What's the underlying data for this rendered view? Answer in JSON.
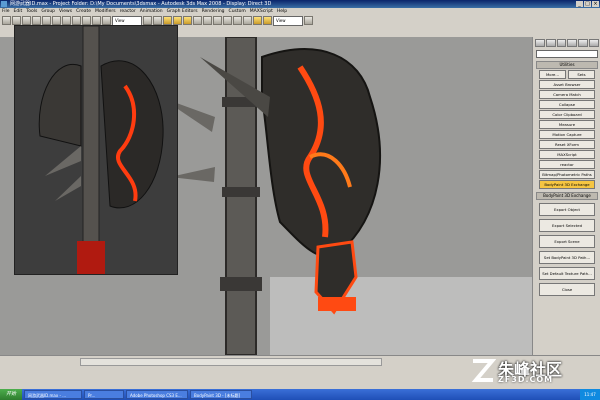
{
  "window": {
    "title": "网游武器ID.max - Project Folder: D:\\My Documents\\3dsmax - Autodesk 3ds Max 2008 - Display: Direct 3D",
    "controls": [
      "_",
      "□",
      "×"
    ]
  },
  "menu": [
    "File",
    "Edit",
    "Tools",
    "Group",
    "Views",
    "Create",
    "Modifiers",
    "reactor",
    "Animation",
    "Graph Editors",
    "Rendering",
    "Custom",
    "MAXScript",
    "Help"
  ],
  "toolbar": {
    "view_combo": "View",
    "view_combo2": "View"
  },
  "viewport": {
    "label": ""
  },
  "command_panel": {
    "utilities_header": "Utilities",
    "row1": [
      "More...",
      "Sets"
    ],
    "buttons": [
      "Asset Browser",
      "Camera Match",
      "Collapse",
      "Color Clipboard",
      "Measure",
      "Motion Capture",
      "Reset XForm",
      "MAXScript",
      "reactor",
      "Bitmap/Photometric Paths",
      "BodyPaint 3D Exchange"
    ],
    "exchange_header": "BodyPaint 3D Exchange",
    "exchange_buttons": [
      "Export Object",
      "Export Selected",
      "Export Scene",
      "Set BodyPaint 3D Path...",
      "Set Default Texture Path...",
      "Close"
    ]
  },
  "taskbar": {
    "start": "开始",
    "items": [
      "网游武器ID.max - ...",
      "Pr...",
      "Adobe Photoshop CS3 E...",
      "BodyPaint 3D - [未标题]"
    ],
    "clock": "11:47"
  },
  "watermark": {
    "main": "朱峰社区",
    "sub": "ZF3D.COM"
  }
}
